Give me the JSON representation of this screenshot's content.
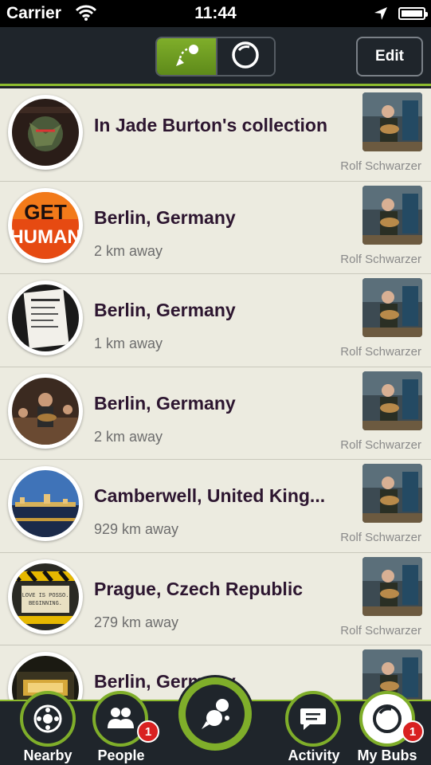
{
  "status": {
    "carrier": "Carrier",
    "time": "11:44"
  },
  "nav": {
    "edit_label": "Edit"
  },
  "list": [
    {
      "title": "In Jade Burton's collection",
      "distance": "",
      "author": "Rolf Schwarzer"
    },
    {
      "title": "Berlin, Germany",
      "distance": "2 km away",
      "author": "Rolf Schwarzer"
    },
    {
      "title": "Berlin, Germany",
      "distance": "1 km away",
      "author": "Rolf Schwarzer"
    },
    {
      "title": "Berlin, Germany",
      "distance": "2 km away",
      "author": "Rolf Schwarzer"
    },
    {
      "title": "Camberwell, United King...",
      "distance": "929 km away",
      "author": "Rolf Schwarzer"
    },
    {
      "title": "Prague, Czech Republic",
      "distance": "279 km away",
      "author": "Rolf Schwarzer"
    },
    {
      "title": "Berlin, Germany",
      "distance": "",
      "author": ""
    }
  ],
  "tabs": {
    "nearby": {
      "label": "Nearby",
      "icon": "nearby-icon"
    },
    "people": {
      "label": "People",
      "icon": "people-icon",
      "badge": "1"
    },
    "center": {
      "icon": "bubble-blower-icon"
    },
    "activity": {
      "label": "Activity",
      "icon": "chat-icon"
    },
    "mybubs": {
      "label": "My Bubs",
      "icon": "bubble-icon",
      "badge": "1"
    }
  },
  "colors": {
    "accent": "#7fae2a",
    "dark": "#1f252b",
    "list_bg": "#ecebe0",
    "title": "#2d1630",
    "badge": "#d92121"
  }
}
